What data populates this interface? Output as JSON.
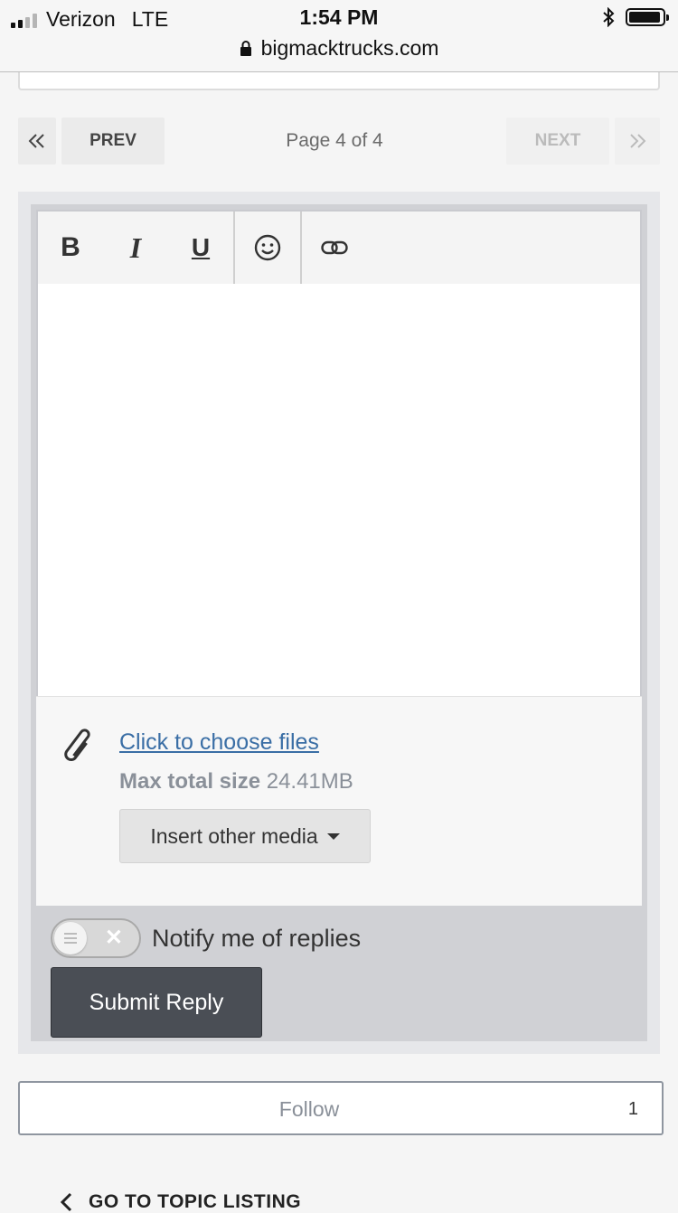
{
  "status_bar": {
    "carrier": "Verizon",
    "network": "LTE",
    "time": "1:54 PM",
    "url": "bigmacktrucks.com",
    "battery_level": 0.95
  },
  "pagination": {
    "first_icon": "double-chevron-left-icon",
    "prev_label": "PREV",
    "page_text": "Page 4 of 4",
    "next_label": "NEXT",
    "last_icon": "double-chevron-right-icon"
  },
  "editor": {
    "toolbar": {
      "bold_label": "B",
      "italic_label": "I",
      "underline_label": "U",
      "emoji_icon": "smiley-icon",
      "link_icon": "link-icon"
    },
    "body_text": ""
  },
  "attachments": {
    "icon": "paperclip-icon",
    "choose_files_label": "Click to choose files ",
    "max_size_label": "Max total size",
    "max_size_value": "24.41MB",
    "insert_media_label": "Insert other media"
  },
  "notify": {
    "label": "Notify me of replies",
    "enabled": false
  },
  "submit_label": "Submit Reply",
  "follow": {
    "label": "Follow",
    "count": "1"
  },
  "topic_listing_label": "GO TO TOPIC LISTING",
  "colors": {
    "link": "#3a6ea5",
    "submit_bg": "#4a4e55",
    "muted_text": "#8a9099"
  }
}
